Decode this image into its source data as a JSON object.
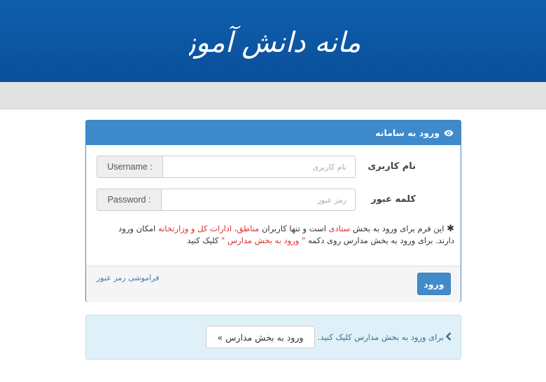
{
  "header": {
    "logo_text": "سامانه دانش آموزی",
    "bg_color": "#0d5aa7"
  },
  "login": {
    "title": "ورود به سامانه",
    "username": {
      "label": "نام کاربری",
      "addon": "Username :",
      "placeholder": "نام کاربری"
    },
    "password": {
      "label": "کلمه عبور",
      "addon": "Password :",
      "placeholder": "رمز عبور"
    },
    "notice": {
      "star": "✱",
      "p1": " این فرم برای ورود به بخش ",
      "r1": "ستادی",
      "p2": " است و تنها کاربران ",
      "r2": "مناطق، ادارات کل و وزارتخانه",
      "p3": " امکان ورود دارند. برای ورود به بخش مدارس روی دکمه ",
      "r3": "\" ورود به بخش مدارس \"",
      "p4": " کلیک کنید"
    },
    "submit_label": "ورود",
    "forgot_label": "فراموشی رمز عبور"
  },
  "school": {
    "text": "برای ورود به بخش مدارس کلیک کنید.",
    "button_label": "ورود به بخش مدارس »"
  },
  "colors": {
    "primary": "#428bca",
    "panel_heading": "#3f8acb",
    "info_bg": "#dff0f8",
    "red_text": "#d9312b"
  }
}
